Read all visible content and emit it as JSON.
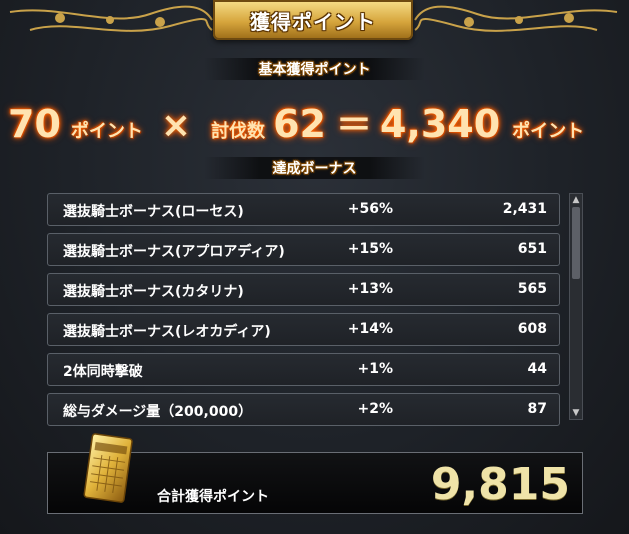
{
  "header": {
    "title": "獲得ポイント",
    "basic_label": "基本獲得ポイント",
    "bonus_label": "達成ボーナス"
  },
  "formula": {
    "base_points": "70",
    "points_unit": "ポイント",
    "times": "×",
    "kills_label": "討伐数",
    "kills": "62",
    "equals": "＝",
    "result": "4,340",
    "result_unit": "ポイント"
  },
  "bonuses": [
    {
      "label": "選抜騎士ボーナス(ローセス)",
      "percent": "+56%",
      "value": "2,431"
    },
    {
      "label": "選抜騎士ボーナス(アプロアディア)",
      "percent": "+15%",
      "value": "651"
    },
    {
      "label": "選抜騎士ボーナス(カタリナ)",
      "percent": "+13%",
      "value": "565"
    },
    {
      "label": "選抜騎士ボーナス(レオカディア)",
      "percent": "+14%",
      "value": "608"
    },
    {
      "label": "2体同時撃破",
      "percent": "+1%",
      "value": "44"
    },
    {
      "label": "総与ダメージ量（200,000）",
      "percent": "+2%",
      "value": "87"
    }
  ],
  "total": {
    "label": "合計獲得ポイント",
    "value": "9,815"
  },
  "colors": {
    "accent_gold": "#d6a53c",
    "glow_orange": "#ff6a00",
    "total_text": "#efe3a8"
  },
  "icons": {
    "scroll_up": "triangle-up-icon",
    "scroll_down": "triangle-down-icon",
    "card": "gold-point-card-icon"
  }
}
